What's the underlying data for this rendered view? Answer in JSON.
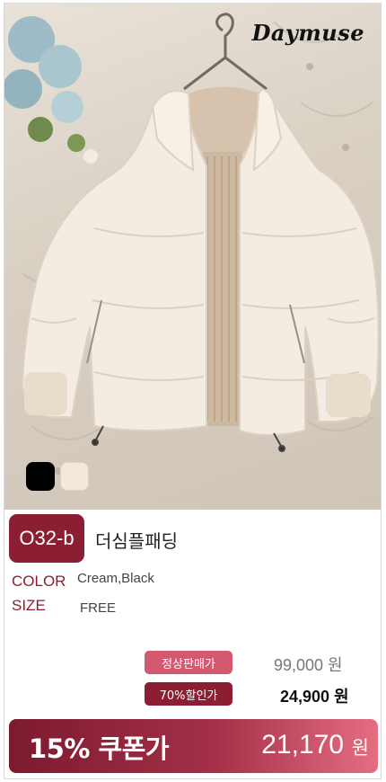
{
  "brand": {
    "logo_text": "Daymuse"
  },
  "photo": {
    "subject": "cream puffer jacket on hanger",
    "icons": [
      "hanger-icon",
      "flower-decoration"
    ]
  },
  "swatches": [
    {
      "name": "black",
      "color": "#000000"
    },
    {
      "name": "cream",
      "color": "#f3e8dc"
    }
  ],
  "product": {
    "code": "O32-b",
    "name": "더심플패딩",
    "color_label": "COLOR",
    "color_value": "Cream,Black",
    "size_label": "SIZE",
    "size_value": "FREE"
  },
  "pricing": {
    "regular_label": "정상판매가",
    "regular_price": "99,000 원",
    "discount_label": "70%할인가",
    "discount_price": "24,900 원"
  },
  "coupon": {
    "label": "15% 쿠폰가",
    "price": "21,170",
    "unit": "원"
  },
  "colors": {
    "accent": "#8b1e32",
    "accent_light": "#d2596e",
    "coupon_gradient_end": "#e56d82"
  }
}
